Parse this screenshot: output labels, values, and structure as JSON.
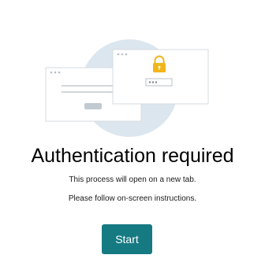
{
  "dialog": {
    "title": "Authentication required",
    "message_line_1": "This process will open on a new tab.",
    "message_line_2": "Please follow on-screen instructions.",
    "start_button_label": "Start"
  },
  "illustration": {
    "icons": [
      "browser-window-icon",
      "lock-icon",
      "password-field-icon"
    ],
    "password_mask": "•••"
  },
  "colors": {
    "accent": "#167a82",
    "circle": "#dce6ee",
    "lock": "#f2b51c",
    "window_border": "#d6dbe0",
    "window_line": "#cfd6dc"
  }
}
